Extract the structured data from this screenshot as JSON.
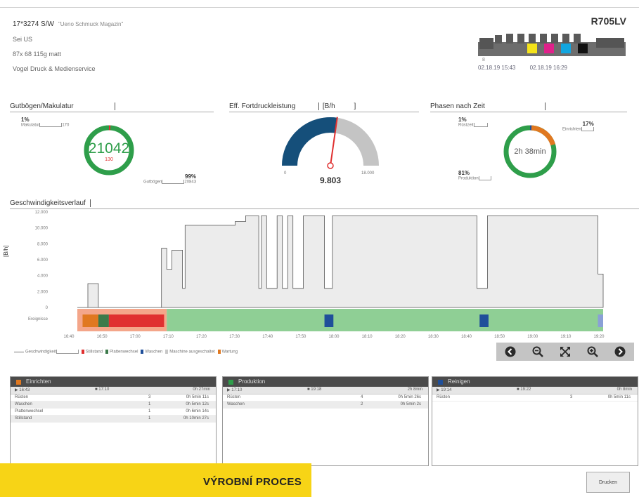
{
  "job": {
    "title": "17*3274 S/W",
    "quoted": "\"Ueno Schmuck Magazin\"",
    "line2": "Sei US",
    "line3": "87x 68 115g matt",
    "line4": "Vogel Druck & Medienservice"
  },
  "machine": {
    "name": "R705LV",
    "small": "8",
    "start": "02.18.19 15:43",
    "end": "02.18.19 16:29",
    "colors": [
      "#f5e31a",
      "#e0218a",
      "#12a6e0",
      "#111111"
    ]
  },
  "good_waste": {
    "heading": "Gutbögen/Makulatur",
    "top_pct": "1%",
    "top_label": "Makulatur",
    "top_value": "170",
    "center_value": "21042",
    "center_sub": "130",
    "bottom_pct": "99%",
    "bottom_label": "Gutbögen",
    "bottom_value": "20843"
  },
  "perf": {
    "heading": "Eff. Fortdruckleistung",
    "unit": "[B/h",
    "unit2": "]",
    "value": "9.803",
    "min": "0",
    "max": "18.000",
    "fill_fraction": 0.545
  },
  "phases_time": {
    "heading": "Phasen nach Zeit",
    "p1_pct": "1%",
    "p1_label": "Rüstzeit",
    "p2_pct": "17%",
    "p2_label": "Einrichten",
    "p3_pct": "81%",
    "p3_label": "Produktion",
    "center": "2h 38min"
  },
  "speed_chart": {
    "heading": "Geschwindigkeitsverlauf",
    "y_title": "[B/h]",
    "y_ticks": [
      "12.000",
      "10.000",
      "8.000",
      "6.000",
      "4.000",
      "2.000",
      "0"
    ],
    "phase_row_label": "Ereignisse",
    "x_ticks": [
      "16:40",
      "16:50",
      "17:00",
      "17:10",
      "17:20",
      "17:30",
      "17:40",
      "17:50",
      "18:00",
      "18:10",
      "18:20",
      "18:30",
      "18:40",
      "18:50",
      "19:00",
      "19:10",
      "19:20"
    ],
    "legend": [
      {
        "label": "Geschwindigkeit",
        "color": "#777777"
      },
      {
        "label": "Stillstand",
        "color": "#e03030"
      },
      {
        "label": "Plattenwechsel",
        "color": "#3c7a4a"
      },
      {
        "label": "Waschen",
        "color": "#1f4f9a"
      },
      {
        "label": "Maschine ausgeschaltet",
        "color": "#c8c8c8"
      },
      {
        "label": "Wartung",
        "color": "#e07820"
      }
    ]
  },
  "controls": {
    "prev": "‹",
    "zoom_out": "−",
    "fit": "⤢",
    "zoom_in": "+",
    "next": "›"
  },
  "panels": [
    {
      "title": "Einrichten",
      "color": "#e07820",
      "start": "16:43",
      "end": "17:10",
      "dur": "0h 27min",
      "rows": [
        {
          "name": "Rüsten",
          "count": "3",
          "time": "0h 5min 11s"
        },
        {
          "name": "Waschen",
          "count": "1",
          "time": "0h 5min 12s"
        },
        {
          "name": "Plattenwechsel",
          "count": "1",
          "time": "0h 6min 14s"
        },
        {
          "name": "Stillstand",
          "count": "1",
          "time": "0h 10min 27s"
        }
      ]
    },
    {
      "title": "Produktion",
      "color": "#2e9e4a",
      "start": "17:10",
      "end": "19:18",
      "dur": "2h 8min",
      "rows": [
        {
          "name": "Rüsten",
          "count": "4",
          "time": "0h 5min 26s"
        },
        {
          "name": "Waschen",
          "count": "2",
          "time": "0h 5min 2s"
        }
      ]
    },
    {
      "title": "Reinigen",
      "color": "#1f4f9a",
      "start": "19:14",
      "end": "19:22",
      "dur": "0h 8min",
      "rows": [
        {
          "name": "Rüsten",
          "count": "3",
          "time": "0h 5min 11s"
        }
      ]
    }
  ],
  "banner": {
    "text": "VÝROBNÍ PROCES"
  },
  "bottom_button": "Drucken"
}
